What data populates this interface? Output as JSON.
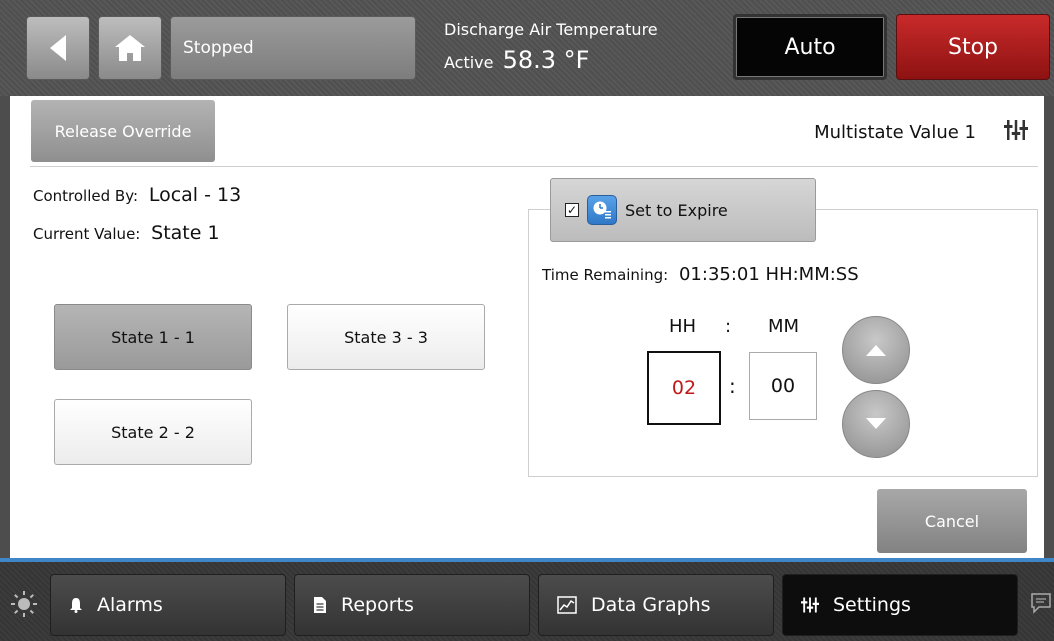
{
  "header": {
    "status": "Stopped",
    "point_label": "Discharge Air Temperature",
    "point_state": "Active",
    "point_value": "58.3 °F",
    "auto_label": "Auto",
    "stop_label": "Stop"
  },
  "toolbar": {
    "release_label": "Release Override",
    "object_title": "Multistate Value 1"
  },
  "info": {
    "controlled_by_label": "Controlled By:",
    "controlled_by_value": "Local - 13",
    "current_value_label": "Current Value:",
    "current_value": "State 1"
  },
  "states": [
    {
      "label": "State 1 - 1",
      "active": true
    },
    {
      "label": "State 3 - 3",
      "active": false
    },
    {
      "label": "State 2 - 2",
      "active": false
    }
  ],
  "expire": {
    "label": "Set to Expire",
    "checked": true,
    "checkmark": "✓",
    "time_remaining_label": "Time Remaining:",
    "time_remaining_value": "01:35:01 HH:MM:SS",
    "hh_label": "HH",
    "colon": ":",
    "mm_label": "MM",
    "hours": "02",
    "minutes": "00"
  },
  "actions": {
    "cancel_label": "Cancel"
  },
  "nav": {
    "alarms": "Alarms",
    "reports": "Reports",
    "data_graphs": "Data Graphs",
    "settings": "Settings"
  },
  "colors": {
    "stop_red": "#b51e1e",
    "hours_red": "#c01818",
    "accent_blue": "#3e86c6"
  }
}
